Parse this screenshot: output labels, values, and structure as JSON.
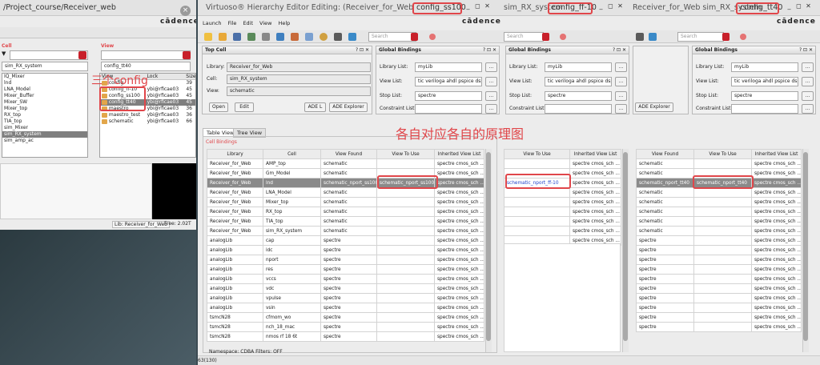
{
  "annotations": {
    "three_configs": "三个config",
    "each_schematic": "各自对应各自的原理图"
  },
  "lib_mgr": {
    "title": "/Project_course/Receiver_web",
    "brand": "cādence",
    "cell_label": "Cell",
    "view_label": "View",
    "cell_value": "sim_RX_system",
    "view_value": "config_tt40",
    "cells": [
      "IQ_Mixer",
      "lnd",
      "LNA_Model",
      "Mixer_Buffer",
      "Mixer_SW",
      "Mixer_top",
      "RX_top",
      "TIA_top",
      "sim_Mixer",
      "sim_RX_system",
      "sim_amp_ac"
    ],
    "cell_selected": 9,
    "view_cols": [
      "View",
      "Lock",
      "Size"
    ],
    "views": [
      [
        "config",
        "",
        "39"
      ],
      [
        "config_ff-10",
        "ybi@rficae03",
        "45"
      ],
      [
        "config_ss100",
        "ybi@rficae03",
        "45"
      ],
      [
        "config_tt40",
        "ybi@rficae03",
        "45"
      ],
      [
        "maestro",
        "ybi@rficae03",
        "36"
      ],
      [
        "maestro_test",
        "ybi@rficae03",
        "36"
      ],
      [
        "schematic",
        "ybi@rficae03",
        "66"
      ]
    ],
    "view_selected": 3,
    "status_lib": "Lib: Receiver_for_Web",
    "status_free": "Free: 2.02T"
  },
  "hed": {
    "title_pre": "Virtuoso® Hierarchy Editor Editing: (Receiver_for_Web sim_RX_system ",
    "title_cfg": "config_ss100",
    "menus": [
      "Launch",
      "File",
      "Edit",
      "View",
      "Help"
    ],
    "search": "Search",
    "top_cell": {
      "head": "Top Cell",
      "library_label": "Library:",
      "library": "Receiver_for_Web",
      "cell_label": "Cell:",
      "cell": "sim_RX_system",
      "view_label": "View:",
      "view": "schematic",
      "open": "Open",
      "edit": "Edit",
      "ade_l": "ADE L",
      "ade_explorer": "ADE Explorer"
    },
    "global": {
      "head": "Global Bindings",
      "lib_list_label": "Library List:",
      "lib_list": "myLib",
      "view_list_label": "View List:",
      "view_list": "tic veriloga ahdl pspice dspf",
      "stop_list_label": "Stop List:",
      "stop_list": "spectre",
      "constraint_label": "Constraint List:",
      "constraint": "",
      "more": "..."
    },
    "tabs": [
      "Table View",
      "Tree View"
    ],
    "cell_bindings": "Cell Bindings",
    "cols": [
      "Library",
      "Cell",
      "View Found",
      "View To Use",
      "Inherited View List"
    ],
    "rows": [
      [
        "Receiver_for_Web",
        "AMP_top",
        "schematic",
        "",
        "spectre cmos_sch ..."
      ],
      [
        "Receiver_for_Web",
        "Gm_Model",
        "schematic",
        "",
        "spectre cmos_sch ..."
      ],
      [
        "Receiver_for_Web",
        "lnd",
        "schematic_nport_ss100",
        "schematic_nport_ss100",
        "spectre cmos_sch ..."
      ],
      [
        "Receiver_for_Web",
        "LNA_Model",
        "schematic",
        "",
        "spectre cmos_sch ..."
      ],
      [
        "Receiver_for_Web",
        "Mixer_top",
        "schematic",
        "",
        "spectre cmos_sch ..."
      ],
      [
        "Receiver_for_Web",
        "RX_top",
        "schematic",
        "",
        "spectre cmos_sch ..."
      ],
      [
        "Receiver_for_Web",
        "TIA_top",
        "schematic",
        "",
        "spectre cmos_sch ..."
      ],
      [
        "Receiver_for_Web",
        "sim_RX_system",
        "schematic",
        "",
        "spectre cmos_sch ..."
      ],
      [
        "analogLib",
        "cap",
        "spectre",
        "",
        "spectre cmos_sch ..."
      ],
      [
        "analogLib",
        "idc",
        "spectre",
        "",
        "spectre cmos_sch ..."
      ],
      [
        "analogLib",
        "nport",
        "spectre",
        "",
        "spectre cmos_sch ..."
      ],
      [
        "analogLib",
        "res",
        "spectre",
        "",
        "spectre cmos_sch ..."
      ],
      [
        "analogLib",
        "vccs",
        "spectre",
        "",
        "spectre cmos_sch ..."
      ],
      [
        "analogLib",
        "vdc",
        "spectre",
        "",
        "spectre cmos_sch ..."
      ],
      [
        "analogLib",
        "vpulse",
        "spectre",
        "",
        "spectre cmos_sch ..."
      ],
      [
        "analogLib",
        "vsin",
        "spectre",
        "",
        "spectre cmos_sch ..."
      ],
      [
        "tsmcN28",
        "cfmom_wo",
        "spectre",
        "",
        "spectre cmos_sch ..."
      ],
      [
        "tsmcN28",
        "nch_18_mac",
        "spectre",
        "",
        "spectre cmos_sch ..."
      ],
      [
        "tsmcN28",
        "nmos rf 18 6t",
        "spectre",
        "",
        "spectre cmos_sch ..."
      ]
    ],
    "sel_row": 2,
    "status": "Namespace: CDBA   Filters: OFF",
    "status_left": "63(130)"
  },
  "win3": {
    "title_pre": "sim_RX_system ",
    "title_cfg": "config_ff-10",
    "search": "Search",
    "cols": [
      "View To Use",
      "Inherited View List"
    ],
    "rows": [
      [
        "",
        "spectre cmos_sch ..."
      ],
      [
        "",
        "spectre cmos_sch ..."
      ],
      [
        "schematic_nport_ff-10",
        "spectre cmos_sch ..."
      ],
      [
        "",
        "spectre cmos_sch ..."
      ],
      [
        "",
        "spectre cmos_sch ..."
      ],
      [
        "",
        "spectre cmos_sch ..."
      ],
      [
        "",
        "spectre cmos_sch ..."
      ],
      [
        "",
        "spectre cmos_sch ..."
      ],
      [
        "",
        "spectre cmos_sch ..."
      ]
    ]
  },
  "win4": {
    "title_pre": "Receiver_for_Web sim_RX_system ",
    "title_cfg": "config_tt40",
    "search": "Search",
    "ade_explorer": "ADE Explorer",
    "cols": [
      "View Found",
      "View To Use",
      "Inherited View List"
    ],
    "rows": [
      [
        "schematic",
        "",
        "spectre cmos_sch ..."
      ],
      [
        "schematic",
        "",
        "spectre cmos_sch ..."
      ],
      [
        "schematic_nport_tt40",
        "schematic_nport_tt40",
        "spectre cmos_sch ..."
      ],
      [
        "schematic",
        "",
        "spectre cmos_sch ..."
      ],
      [
        "schematic",
        "",
        "spectre cmos_sch ..."
      ],
      [
        "schematic",
        "",
        "spectre cmos_sch ..."
      ],
      [
        "schematic",
        "",
        "spectre cmos_sch ..."
      ],
      [
        "schematic",
        "",
        "spectre cmos_sch ..."
      ],
      [
        "spectre",
        "",
        "spectre cmos_sch ..."
      ],
      [
        "spectre",
        "",
        "spectre cmos_sch ..."
      ],
      [
        "spectre",
        "",
        "spectre cmos_sch ..."
      ],
      [
        "spectre",
        "",
        "spectre cmos_sch ..."
      ],
      [
        "spectre",
        "",
        "spectre cmos_sch ..."
      ],
      [
        "spectre",
        "",
        "spectre cmos_sch ..."
      ],
      [
        "spectre",
        "",
        "spectre cmos_sch ..."
      ],
      [
        "spectre",
        "",
        "spectre cmos_sch ..."
      ],
      [
        "spectre",
        "",
        "spectre cmos_sch ..."
      ],
      [
        "spectre",
        "",
        "spectre cmos_sch ..."
      ]
    ],
    "sel_row": 2
  }
}
